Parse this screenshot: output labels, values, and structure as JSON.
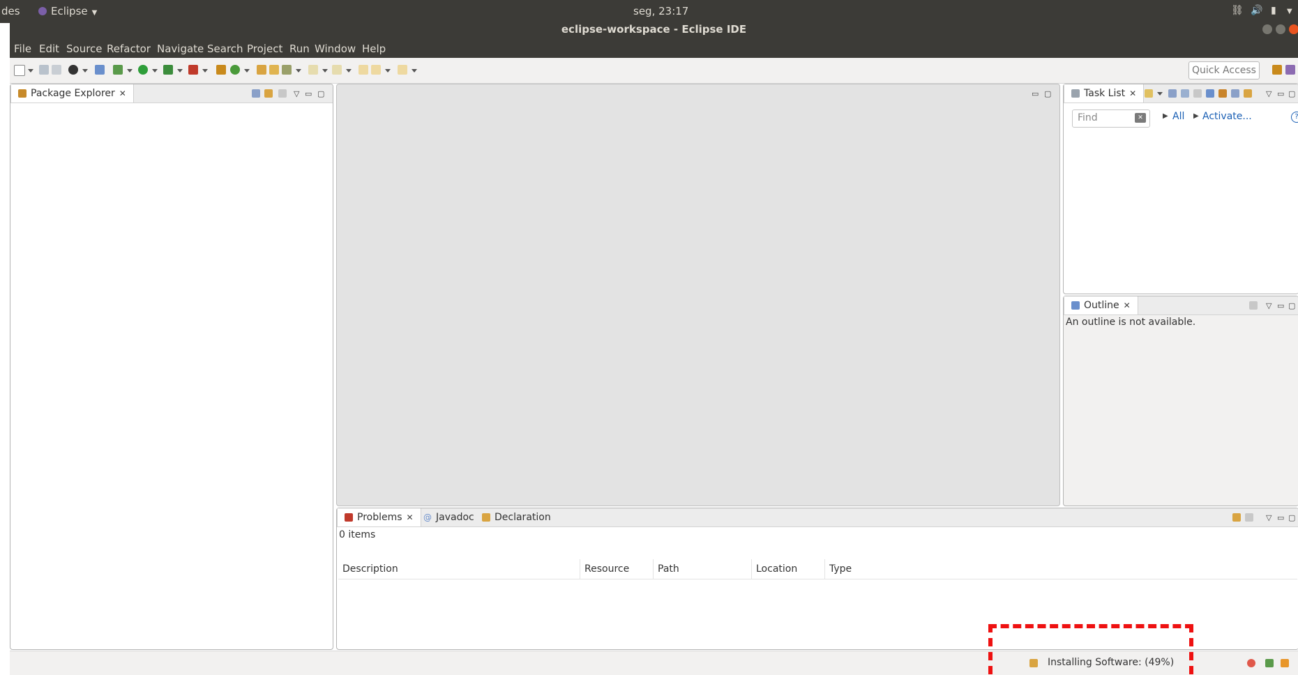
{
  "topbar": {
    "activities": "des",
    "app_menu": "Eclipse",
    "clock": "seg, 23:17"
  },
  "window": {
    "title": "eclipse-workspace - Eclipse IDE"
  },
  "menubar": {
    "items": [
      "File",
      "Edit",
      "Source",
      "Refactor",
      "Navigate",
      "Search",
      "Project",
      "Run",
      "Window",
      "Help"
    ]
  },
  "toolbar": {
    "quick_access": "Quick Access"
  },
  "package_explorer": {
    "tab_label": "Package Explorer"
  },
  "task_list": {
    "tab_label": "Task List",
    "find_placeholder": "Find",
    "all_link": "All",
    "activate_link": "Activate..."
  },
  "outline": {
    "tab_label": "Outline",
    "message": "An outline is not available."
  },
  "bottom_panel": {
    "tabs": [
      "Problems",
      "Javadoc",
      "Declaration"
    ],
    "items_count": "0 items",
    "columns": [
      "Description",
      "Resource",
      "Path",
      "Location",
      "Type"
    ]
  },
  "statusbar": {
    "progress_text": "Installing Software: (49%)"
  },
  "colors": {
    "ubuntu_bar": "#3c3b37",
    "link_blue": "#1a5fb4",
    "highlight_red": "#ee1111"
  }
}
